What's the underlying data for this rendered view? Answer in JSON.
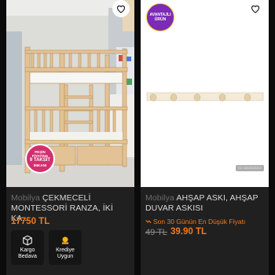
{
  "left_card": {
    "brand": "Mobilya",
    "title": "ÇEKMECELİ MONTESSORİ RANZA, İKİ KA...",
    "price": "17750 TL",
    "promo": {
      "line1": "PEŞİN",
      "line2": "FİYATINA",
      "line3": "9 TAKSİT",
      "line4": "İMKANI"
    },
    "badges": [
      {
        "label": "Kargo Bedava",
        "icon": "box-icon"
      },
      {
        "label": "Krediye Uygun",
        "icon": "credit-icon"
      }
    ]
  },
  "right_card": {
    "brand": "Mobilya",
    "title": "AHŞAP ASKI, AHŞAP DUVAR ASKISI",
    "deal_text": "Son 30 Günün En Düşük Fiyatı",
    "old_price": "49 TL",
    "new_price": "39.90 TL",
    "avantaj": {
      "line1": "AVANTAJLI",
      "line2": "ÜRÜN"
    }
  },
  "colors": {
    "accent": "#f27a1a",
    "background": "#0b0b0b",
    "card": "#202020"
  }
}
